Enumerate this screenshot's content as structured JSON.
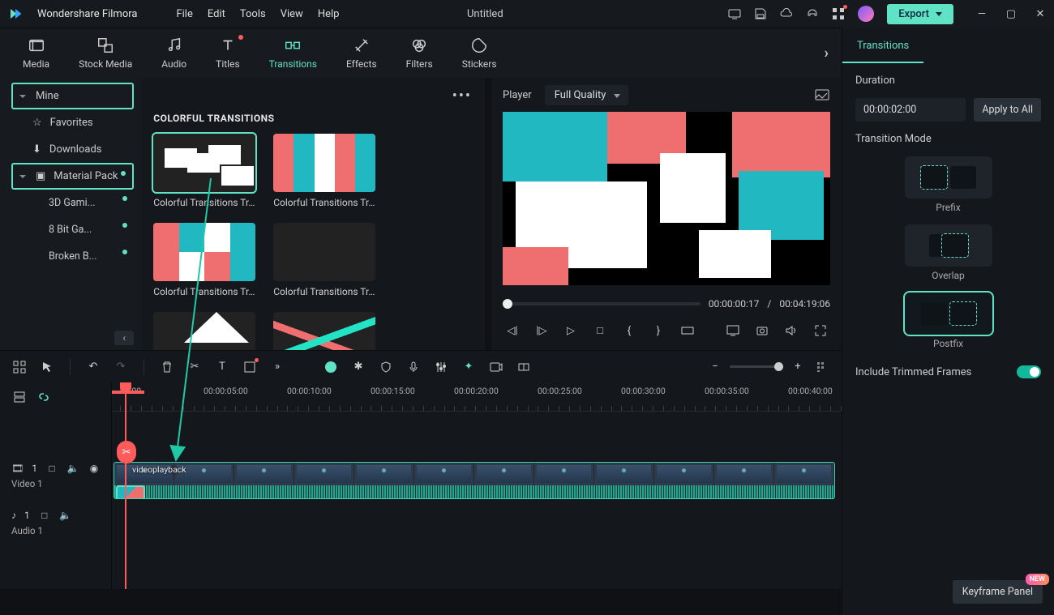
{
  "app": {
    "name": "Wondershare Filmora",
    "project": "Untitled"
  },
  "menus": [
    "File",
    "Edit",
    "Tools",
    "View",
    "Help"
  ],
  "export_label": "Export",
  "ribbon": [
    {
      "id": "media",
      "label": "Media"
    },
    {
      "id": "stock",
      "label": "Stock Media"
    },
    {
      "id": "audio",
      "label": "Audio"
    },
    {
      "id": "titles",
      "label": "Titles",
      "dot": true
    },
    {
      "id": "transitions",
      "label": "Transitions",
      "active": true
    },
    {
      "id": "effects",
      "label": "Effects"
    },
    {
      "id": "filters",
      "label": "Filters"
    },
    {
      "id": "stickers",
      "label": "Stickers"
    }
  ],
  "sidebar": {
    "mine": "Mine",
    "favorites": "Favorites",
    "downloads": "Downloads",
    "material": "Material Pack",
    "subs": [
      {
        "label": "3D Gami..."
      },
      {
        "label": "8 Bit Ga..."
      },
      {
        "label": "Broken B..."
      }
    ]
  },
  "browser": {
    "section": "COLORFUL TRANSITIONS",
    "items": [
      {
        "label": "Colorful Transitions Tr...",
        "th": "th1",
        "sel": true
      },
      {
        "label": "Colorful Transitions Tr...",
        "th": "th2"
      },
      {
        "label": "Colorful Transitions Tr...",
        "th": "th3"
      },
      {
        "label": "Colorful Transitions Tr...",
        "th": "th4"
      },
      {
        "label": "",
        "th": "th5"
      },
      {
        "label": "",
        "th": "th6"
      }
    ]
  },
  "preview": {
    "label": "Player",
    "quality": "Full Quality",
    "tc_cur": "00:00:00:17",
    "tc_sep": "/",
    "tc_tot": "00:04:19:06"
  },
  "ruler": [
    "00:00",
    "00:00:05:00",
    "00:00:10:00",
    "00:00:15:00",
    "00:00:20:00",
    "00:00:25:00",
    "00:00:30:00",
    "00:00:35:00",
    "00:00:40:00"
  ],
  "tracks": {
    "video": "Video 1",
    "audio": "Audio 1",
    "clip": "videoplayback"
  },
  "props": {
    "tab": "Transitions",
    "duration_lbl": "Duration",
    "duration_val": "00:00:02:00",
    "apply_all": "Apply to All",
    "mode_lbl": "Transition Mode",
    "modes": [
      "Prefix",
      "Overlap",
      "Postfix"
    ],
    "mode_sel": 2,
    "trim_lbl": "Include Trimmed Frames",
    "keyframe": "Keyframe Panel",
    "new": "NEW"
  }
}
